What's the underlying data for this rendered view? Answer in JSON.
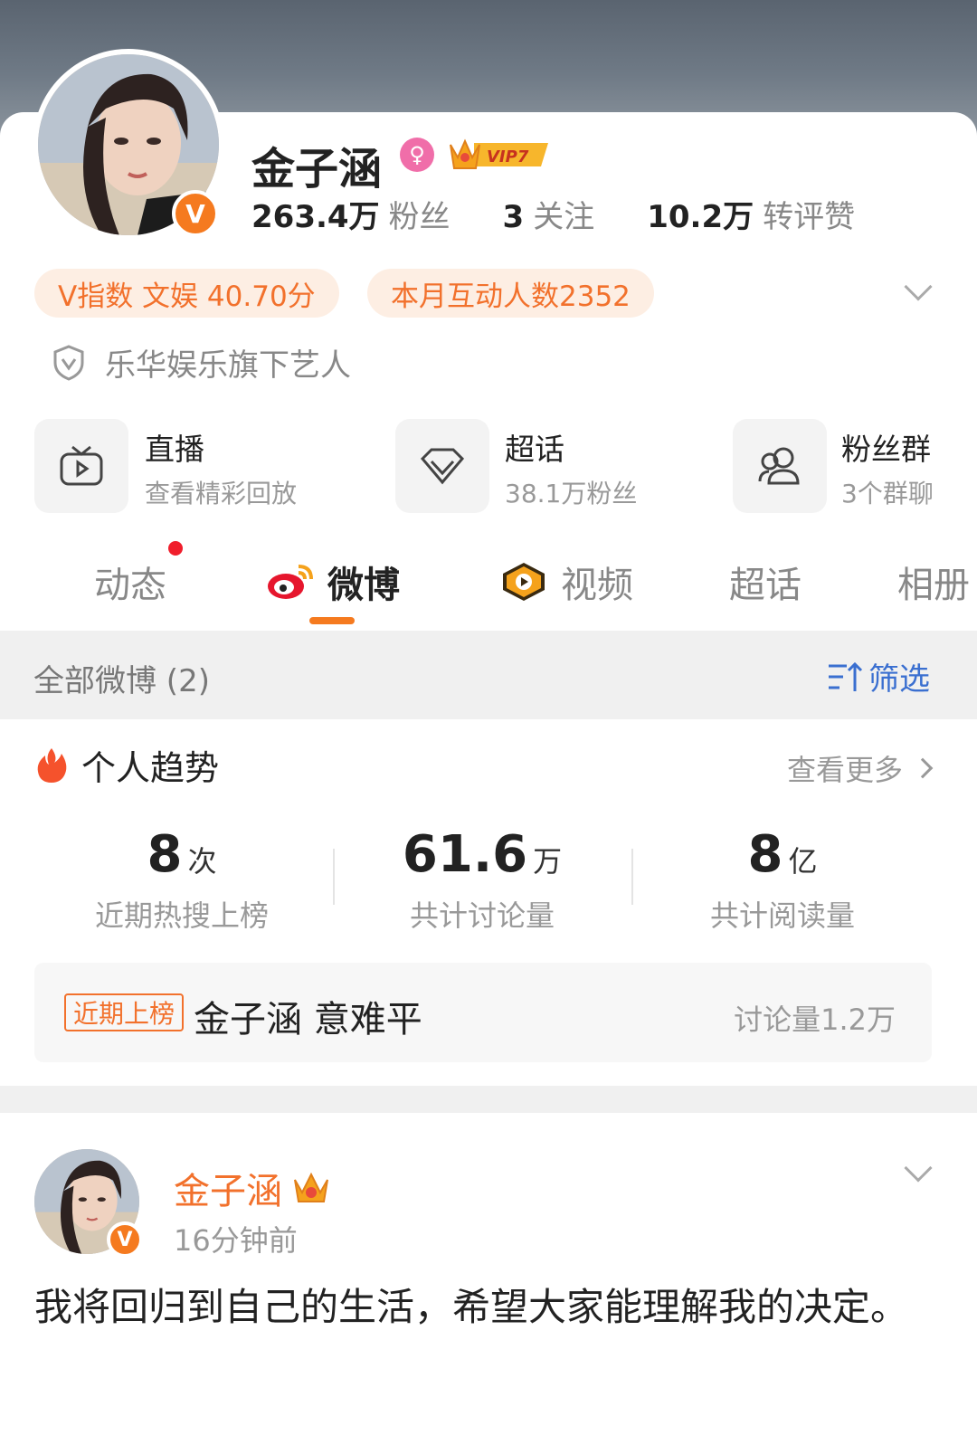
{
  "profile": {
    "name": "金子涵",
    "verified_mark": "V",
    "vip_label": "VIP7",
    "stats": [
      {
        "value": "263.4万",
        "label": "粉丝"
      },
      {
        "value": "3",
        "label": "关注"
      },
      {
        "value": "10.2万",
        "label": "转评赞"
      }
    ],
    "pills": [
      "V指数 文娱 40.70分",
      "本月互动人数2352"
    ],
    "verification": "乐华娱乐旗下艺人"
  },
  "quick_links": [
    {
      "title": "直播",
      "subtitle": "查看精彩回放",
      "icon": "live-tv-icon"
    },
    {
      "title": "超话",
      "subtitle": "38.1万粉丝",
      "icon": "diamond-icon"
    },
    {
      "title": "粉丝群",
      "subtitle": "3个群聊",
      "icon": "group-icon"
    }
  ],
  "tabs": [
    "动态",
    "微博",
    "视频",
    "超话",
    "相册"
  ],
  "active_tab": "微博",
  "filter_bar": {
    "title": "全部微博 (2)",
    "filter_label": "筛选"
  },
  "trend": {
    "title": "个人趋势",
    "more": "查看更多",
    "metrics": [
      {
        "value": "8",
        "unit": "次",
        "label": "近期热搜上榜"
      },
      {
        "value": "61.6",
        "unit": "万",
        "label": "共计讨论量"
      },
      {
        "value": "8",
        "unit": "亿",
        "label": "共计阅读量"
      }
    ],
    "hot": {
      "tag": "近期上榜",
      "title": "金子涵 意难平",
      "count": "讨论量1.2万"
    }
  },
  "post": {
    "author": "金子涵",
    "time": "16分钟前",
    "text": "我将回归到自己的生活，希望大家能理解我的决定。"
  },
  "colors": {
    "accent": "#f2712c",
    "pill_bg": "#fdeee3",
    "link_blue": "#3a6fd0",
    "verified": "#f57a1f"
  }
}
